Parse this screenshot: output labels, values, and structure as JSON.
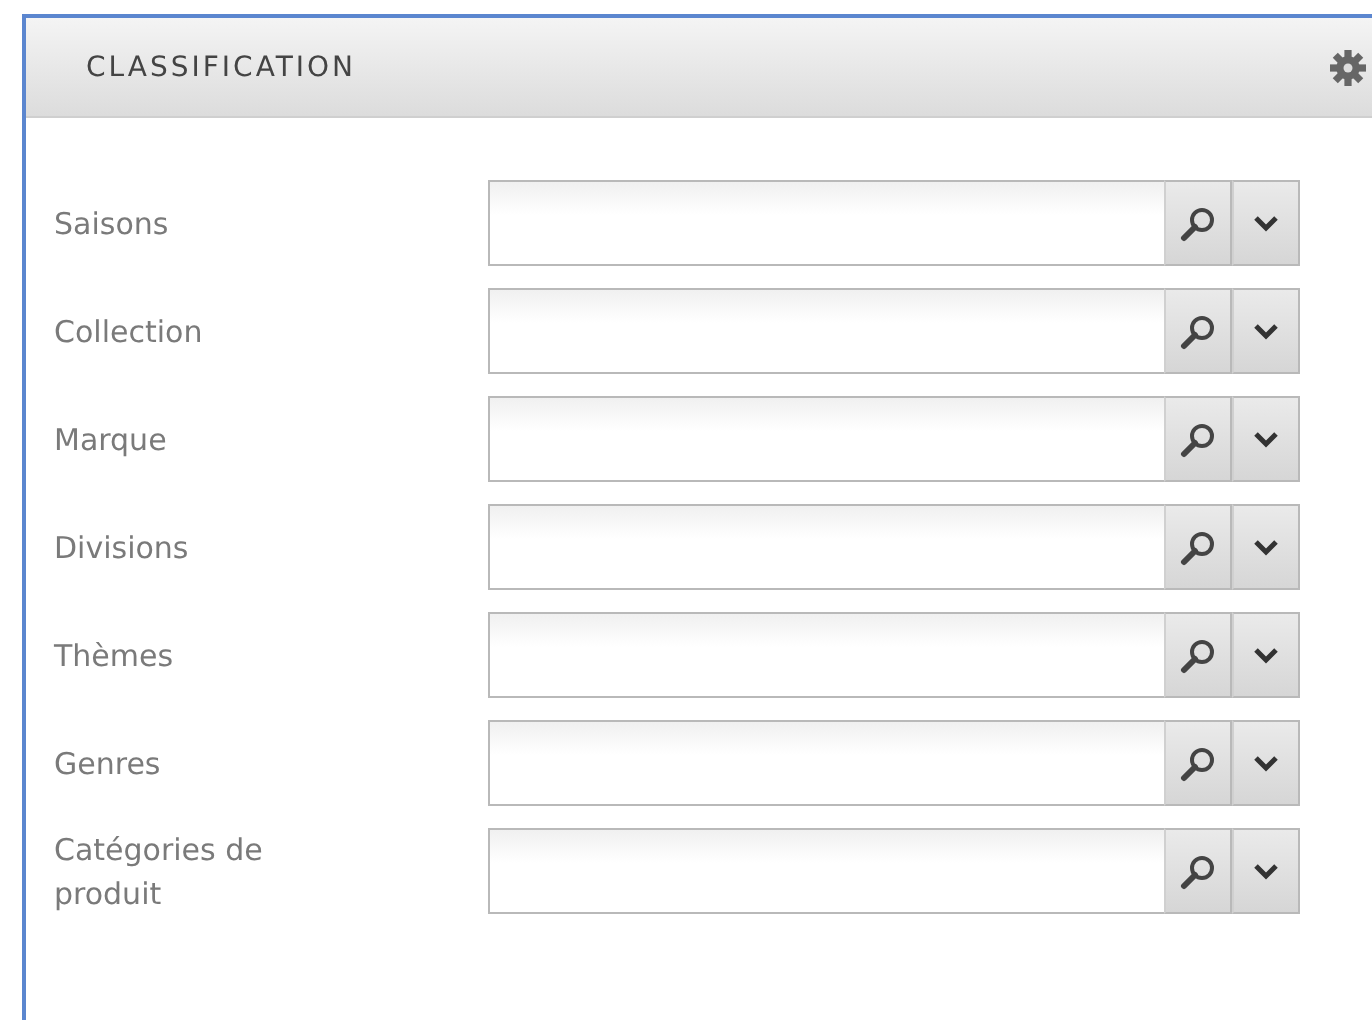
{
  "panel": {
    "title": "CLASSIFICATION"
  },
  "fields": [
    {
      "label": "Saisons"
    },
    {
      "label": "Collection"
    },
    {
      "label": "Marque"
    },
    {
      "label": "Divisions"
    },
    {
      "label": "Thèmes"
    },
    {
      "label": "Genres"
    },
    {
      "label": "Catégories de produit"
    }
  ]
}
